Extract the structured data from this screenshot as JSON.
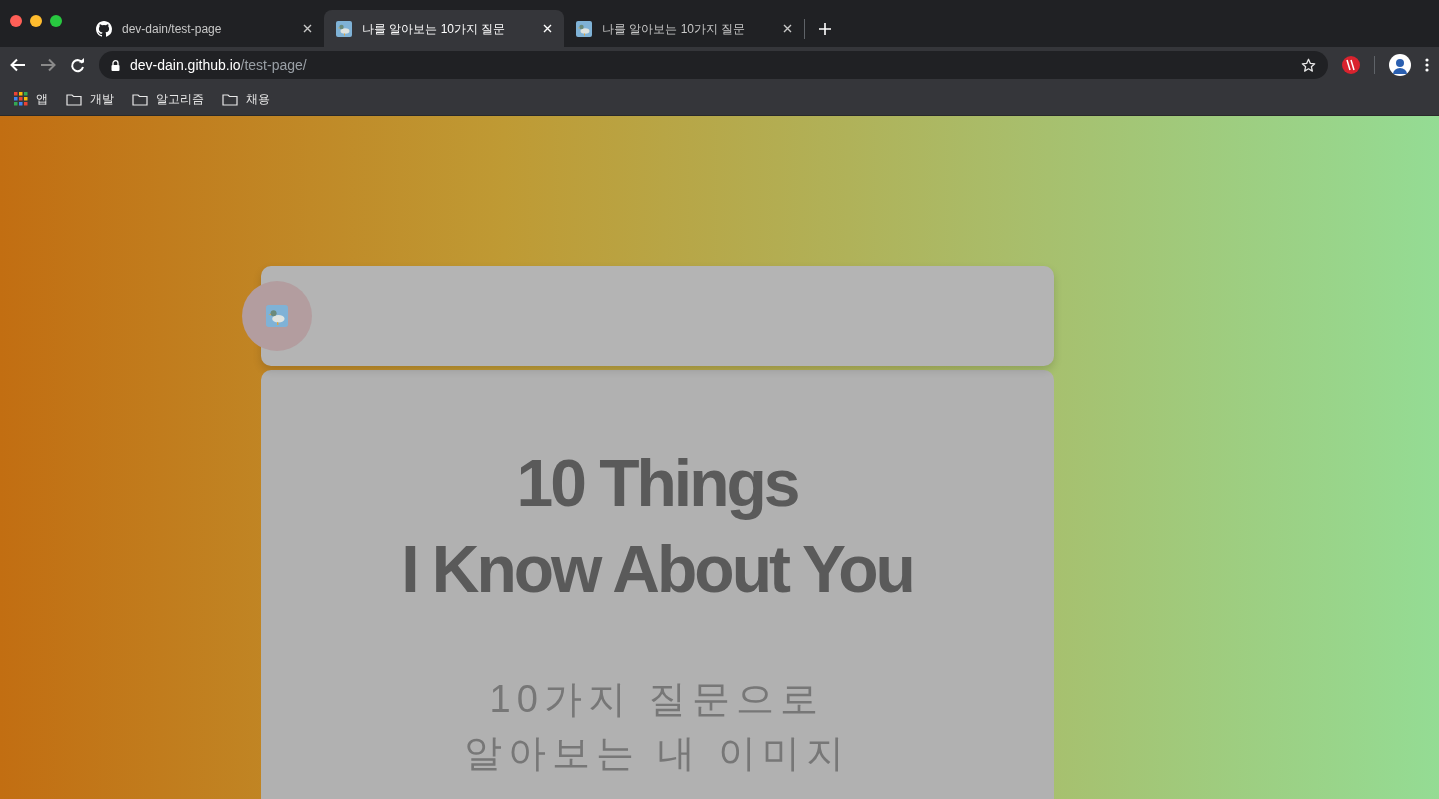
{
  "tabs": [
    {
      "title": "dev-dain/test-page",
      "selected": false
    },
    {
      "title": "나를 알아보는 10가지 질문",
      "selected": true
    },
    {
      "title": "나를 알아보는 10가지 질문",
      "selected": false
    }
  ],
  "address": {
    "host": "dev-dain.github.io",
    "path": "/test-page/"
  },
  "bookmarks": [
    {
      "label": "앱",
      "kind": "apps"
    },
    {
      "label": "개발",
      "kind": "folder"
    },
    {
      "label": "알고리즘",
      "kind": "folder"
    },
    {
      "label": "채용",
      "kind": "folder"
    }
  ],
  "page": {
    "title_lines": [
      "10 Things",
      "I Know About You"
    ],
    "subtitle_lines": [
      "10가지 질문으로",
      "알아보는 내 이미지"
    ]
  }
}
